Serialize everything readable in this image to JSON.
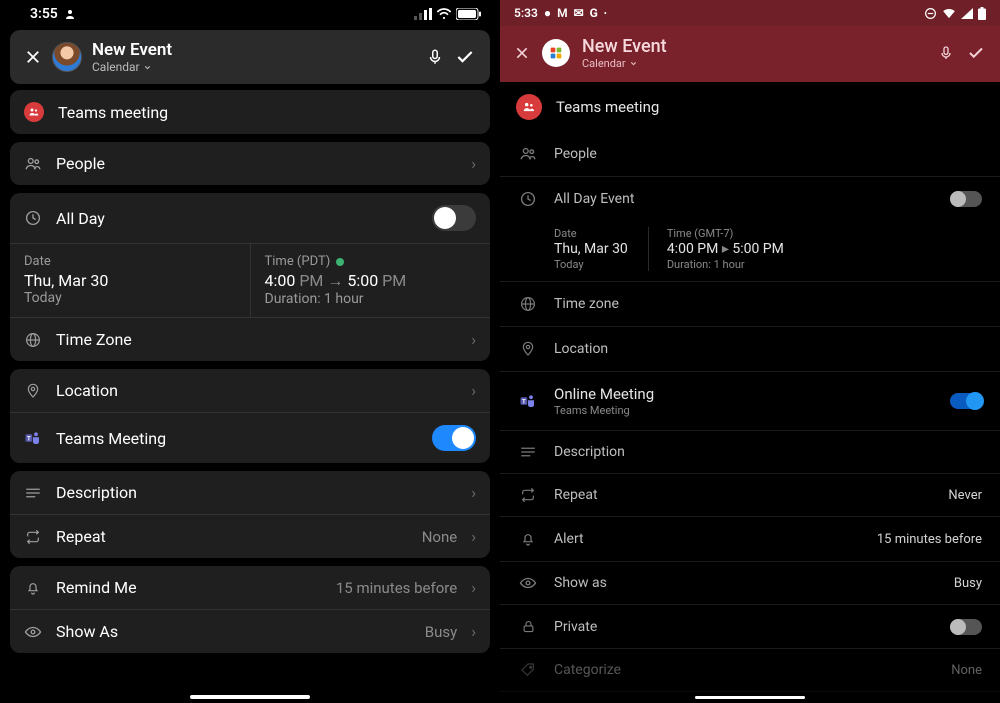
{
  "ios": {
    "status": {
      "time": "3:55",
      "signal": "▪▮",
      "wifi": "wifi",
      "battery": "bat"
    },
    "header": {
      "title": "New Event",
      "sub": "Calendar"
    },
    "teams_meeting": "Teams meeting",
    "people": "People",
    "allday": {
      "label": "All Day",
      "on": false
    },
    "date": {
      "label": "Date",
      "value": "Thu, Mar 30",
      "sub": "Today"
    },
    "time": {
      "label": "Time (PDT)",
      "start": "4:00",
      "start_ampm": "PM",
      "end": "5:00",
      "end_ampm": "PM",
      "duration": "Duration: 1 hour"
    },
    "timezone": "Time Zone",
    "location": "Location",
    "teams_toggle": {
      "label": "Teams Meeting",
      "on": true
    },
    "description": "Description",
    "repeat": {
      "label": "Repeat",
      "value": "None"
    },
    "remind": {
      "label": "Remind Me",
      "value": "15 minutes before"
    },
    "showas": {
      "label": "Show As",
      "value": "Busy"
    }
  },
  "android": {
    "status": {
      "time": "5:33"
    },
    "header": {
      "title": "New Event",
      "sub": "Calendar"
    },
    "teams_meeting": "Teams meeting",
    "people": "People",
    "allday": {
      "label": "All Day Event",
      "on": false
    },
    "date": {
      "label": "Date",
      "value": "Thu, Mar 30",
      "sub": "Today"
    },
    "time": {
      "label": "Time (GMT-7)",
      "start": "4:00 PM",
      "end": "5:00 PM",
      "duration": "Duration: 1 hour"
    },
    "timezone": "Time zone",
    "location": "Location",
    "online": {
      "label": "Online Meeting",
      "sub": "Teams Meeting",
      "on": true
    },
    "description": "Description",
    "repeat": {
      "label": "Repeat",
      "value": "Never"
    },
    "alert": {
      "label": "Alert",
      "value": "15 minutes before"
    },
    "showas": {
      "label": "Show as",
      "value": "Busy"
    },
    "private": {
      "label": "Private",
      "on": false
    },
    "categorize": {
      "label": "Categorize",
      "value": "None"
    }
  }
}
